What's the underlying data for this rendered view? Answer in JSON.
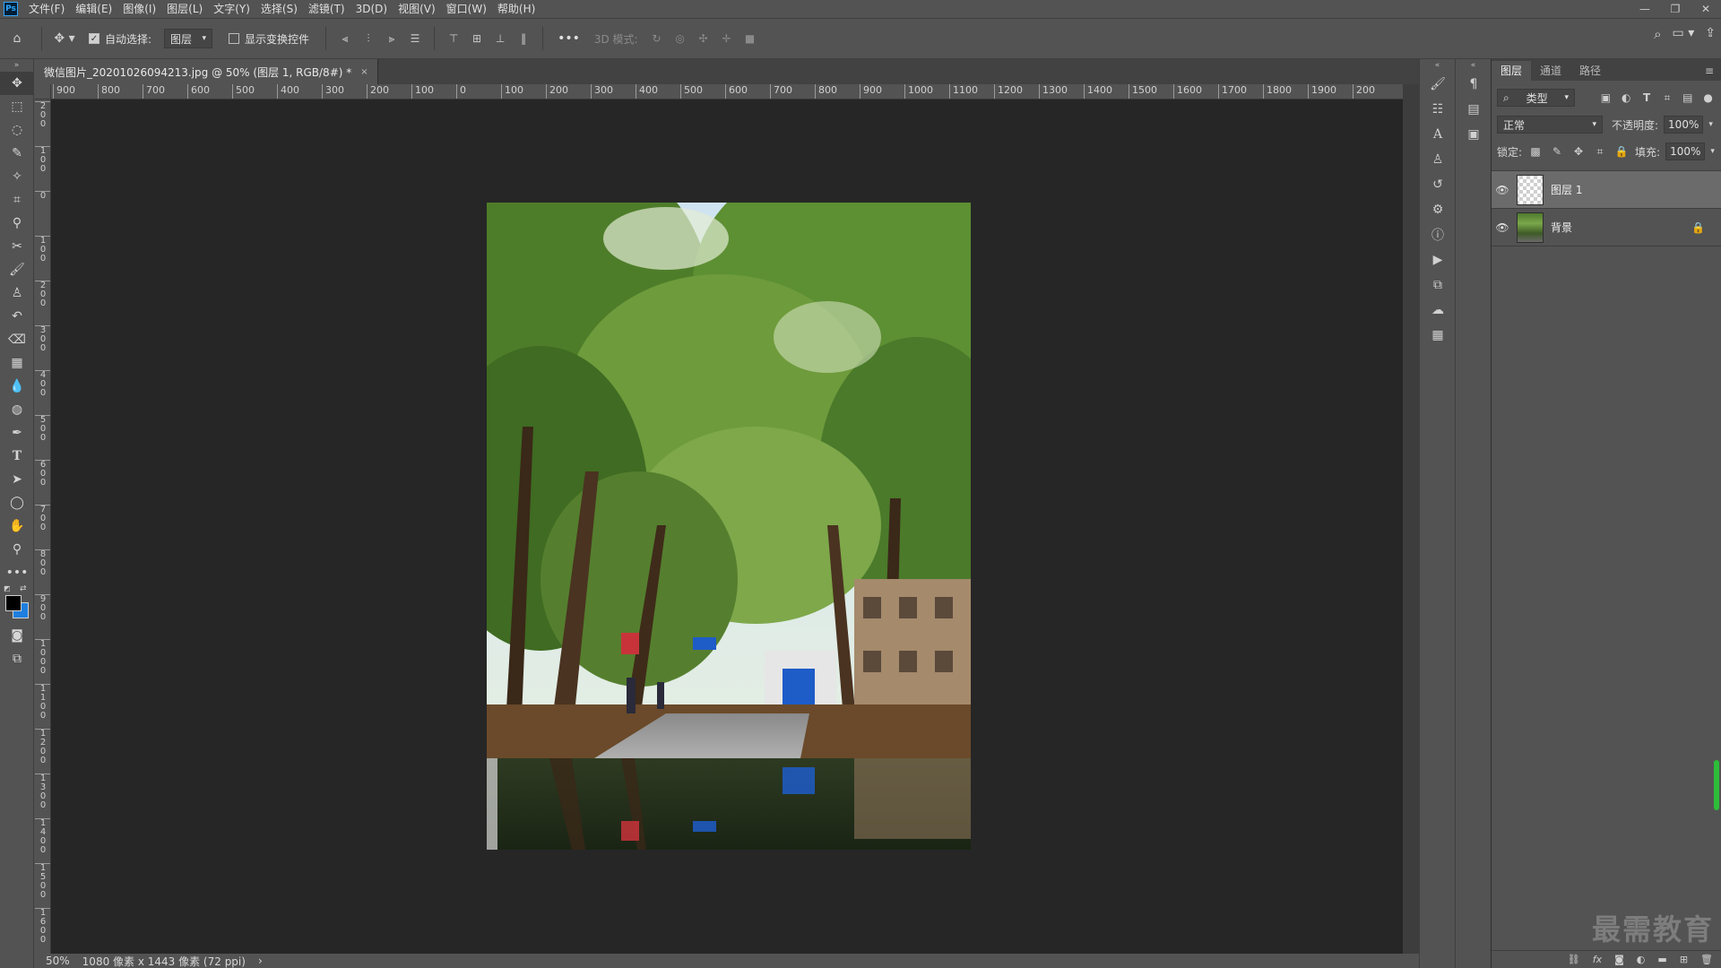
{
  "app": {
    "logo": "Ps"
  },
  "menu": [
    "文件(F)",
    "编辑(E)",
    "图像(I)",
    "图层(L)",
    "文字(Y)",
    "选择(S)",
    "滤镜(T)",
    "3D(D)",
    "视图(V)",
    "窗口(W)",
    "帮助(H)"
  ],
  "options": {
    "auto_select_label": "自动选择:",
    "auto_select_target": "图层",
    "show_transform_label": "显示变换控件",
    "more": "•••",
    "mode_3d_label": "3D 模式:"
  },
  "document": {
    "tab_title": "微信图片_20201026094213.jpg @ 50% (图层 1, RGB/8#) *",
    "close": "×"
  },
  "ruler_h": [
    "900",
    "800",
    "700",
    "600",
    "500",
    "400",
    "300",
    "200",
    "100",
    "0",
    "100",
    "200",
    "300",
    "400",
    "500",
    "600",
    "700",
    "800",
    "900",
    "1000",
    "1100",
    "1200",
    "1300",
    "1400",
    "1500",
    "1600",
    "1700",
    "1800",
    "1900",
    "200"
  ],
  "ruler_v": [
    "200",
    "100",
    "0",
    "100",
    "200",
    "300",
    "400",
    "500",
    "600",
    "700",
    "800",
    "900",
    "1000",
    "1100",
    "1200",
    "1300",
    "1400",
    "1500",
    "1600"
  ],
  "status": {
    "zoom": "50%",
    "info": "1080 像素 x 1443 像素 (72 ppi)",
    "arrow": "›"
  },
  "layers_panel": {
    "tabs": [
      "图层",
      "通道",
      "路径"
    ],
    "filter_kind": "类型",
    "blend_mode": "正常",
    "opacity_label": "不透明度:",
    "opacity_value": "100%",
    "lock_label": "锁定:",
    "fill_label": "填充:",
    "fill_value": "100%",
    "layers": [
      {
        "name": "图层 1",
        "selected": true,
        "locked": false
      },
      {
        "name": "背景",
        "selected": false,
        "locked": true
      }
    ],
    "bottom_icons": [
      "link-icon",
      "fx",
      "mask-icon",
      "adjustment-icon",
      "folder-icon",
      "new-layer-icon",
      "trash-icon"
    ]
  },
  "watermark": "最需教育",
  "colors": {
    "foreground": "#000000",
    "background": "#1e7fe0",
    "accent": "#31a8ff"
  }
}
